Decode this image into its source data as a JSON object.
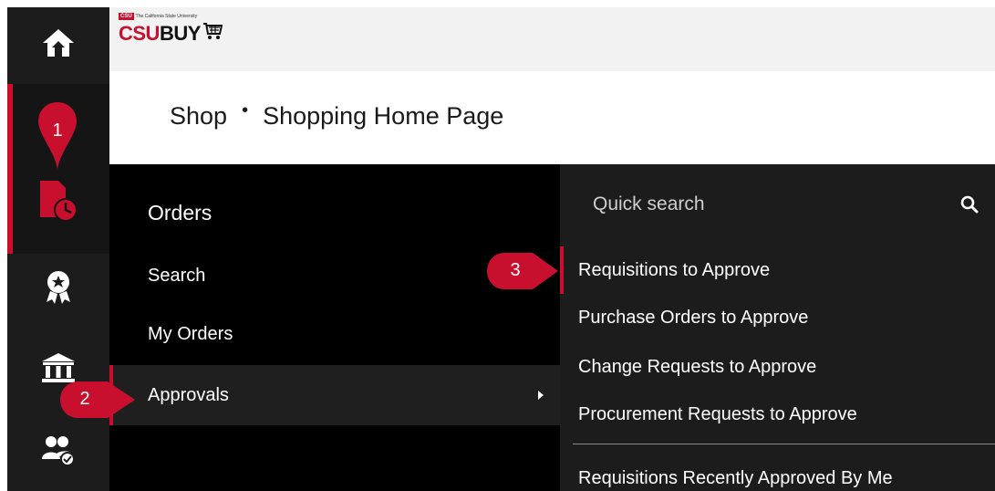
{
  "header": {
    "logo_tag": "CSU",
    "logo_tagline": "The California State University",
    "logo_csu": "CSU",
    "logo_buy": "BUY"
  },
  "breadcrumb": {
    "section": "Shop",
    "separator": "•",
    "page": "Shopping Home Page"
  },
  "rail": {
    "items": [
      {
        "icon": "home-icon"
      },
      {
        "icon": "orders-clock-icon",
        "active": true
      },
      {
        "icon": "award-icon"
      },
      {
        "icon": "bank-icon"
      },
      {
        "icon": "people-check-icon"
      }
    ]
  },
  "orders_menu": {
    "title": "Orders",
    "items": [
      "Search",
      "My Orders",
      "Approvals"
    ]
  },
  "approvals_menu": {
    "search_placeholder": "Quick search",
    "items": [
      "Requisitions to Approve",
      "Purchase Orders to Approve",
      "Change Requests to Approve",
      "Procurement Requests to Approve",
      "Requisitions Recently Approved By Me"
    ]
  },
  "callouts": [
    "1",
    "2",
    "3"
  ],
  "colors": {
    "accent": "#c8102e",
    "rail": "#1c1c1c",
    "menu": "#000000",
    "submenu": "#1c1c1c"
  }
}
